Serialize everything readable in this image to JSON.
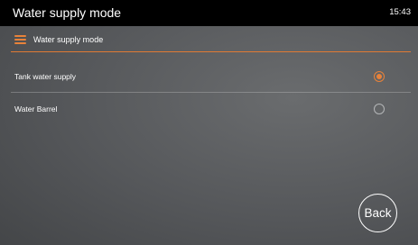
{
  "status_bar": {
    "title": "Water supply mode",
    "time": "15:43"
  },
  "header": {
    "icon": "menu-icon",
    "label": "Water supply mode",
    "accent_color": "#e8823a"
  },
  "options": [
    {
      "label": "Tank water supply",
      "selected": true
    },
    {
      "label": "Water Barrel",
      "selected": false
    }
  ],
  "back_button": {
    "label": "Back"
  }
}
